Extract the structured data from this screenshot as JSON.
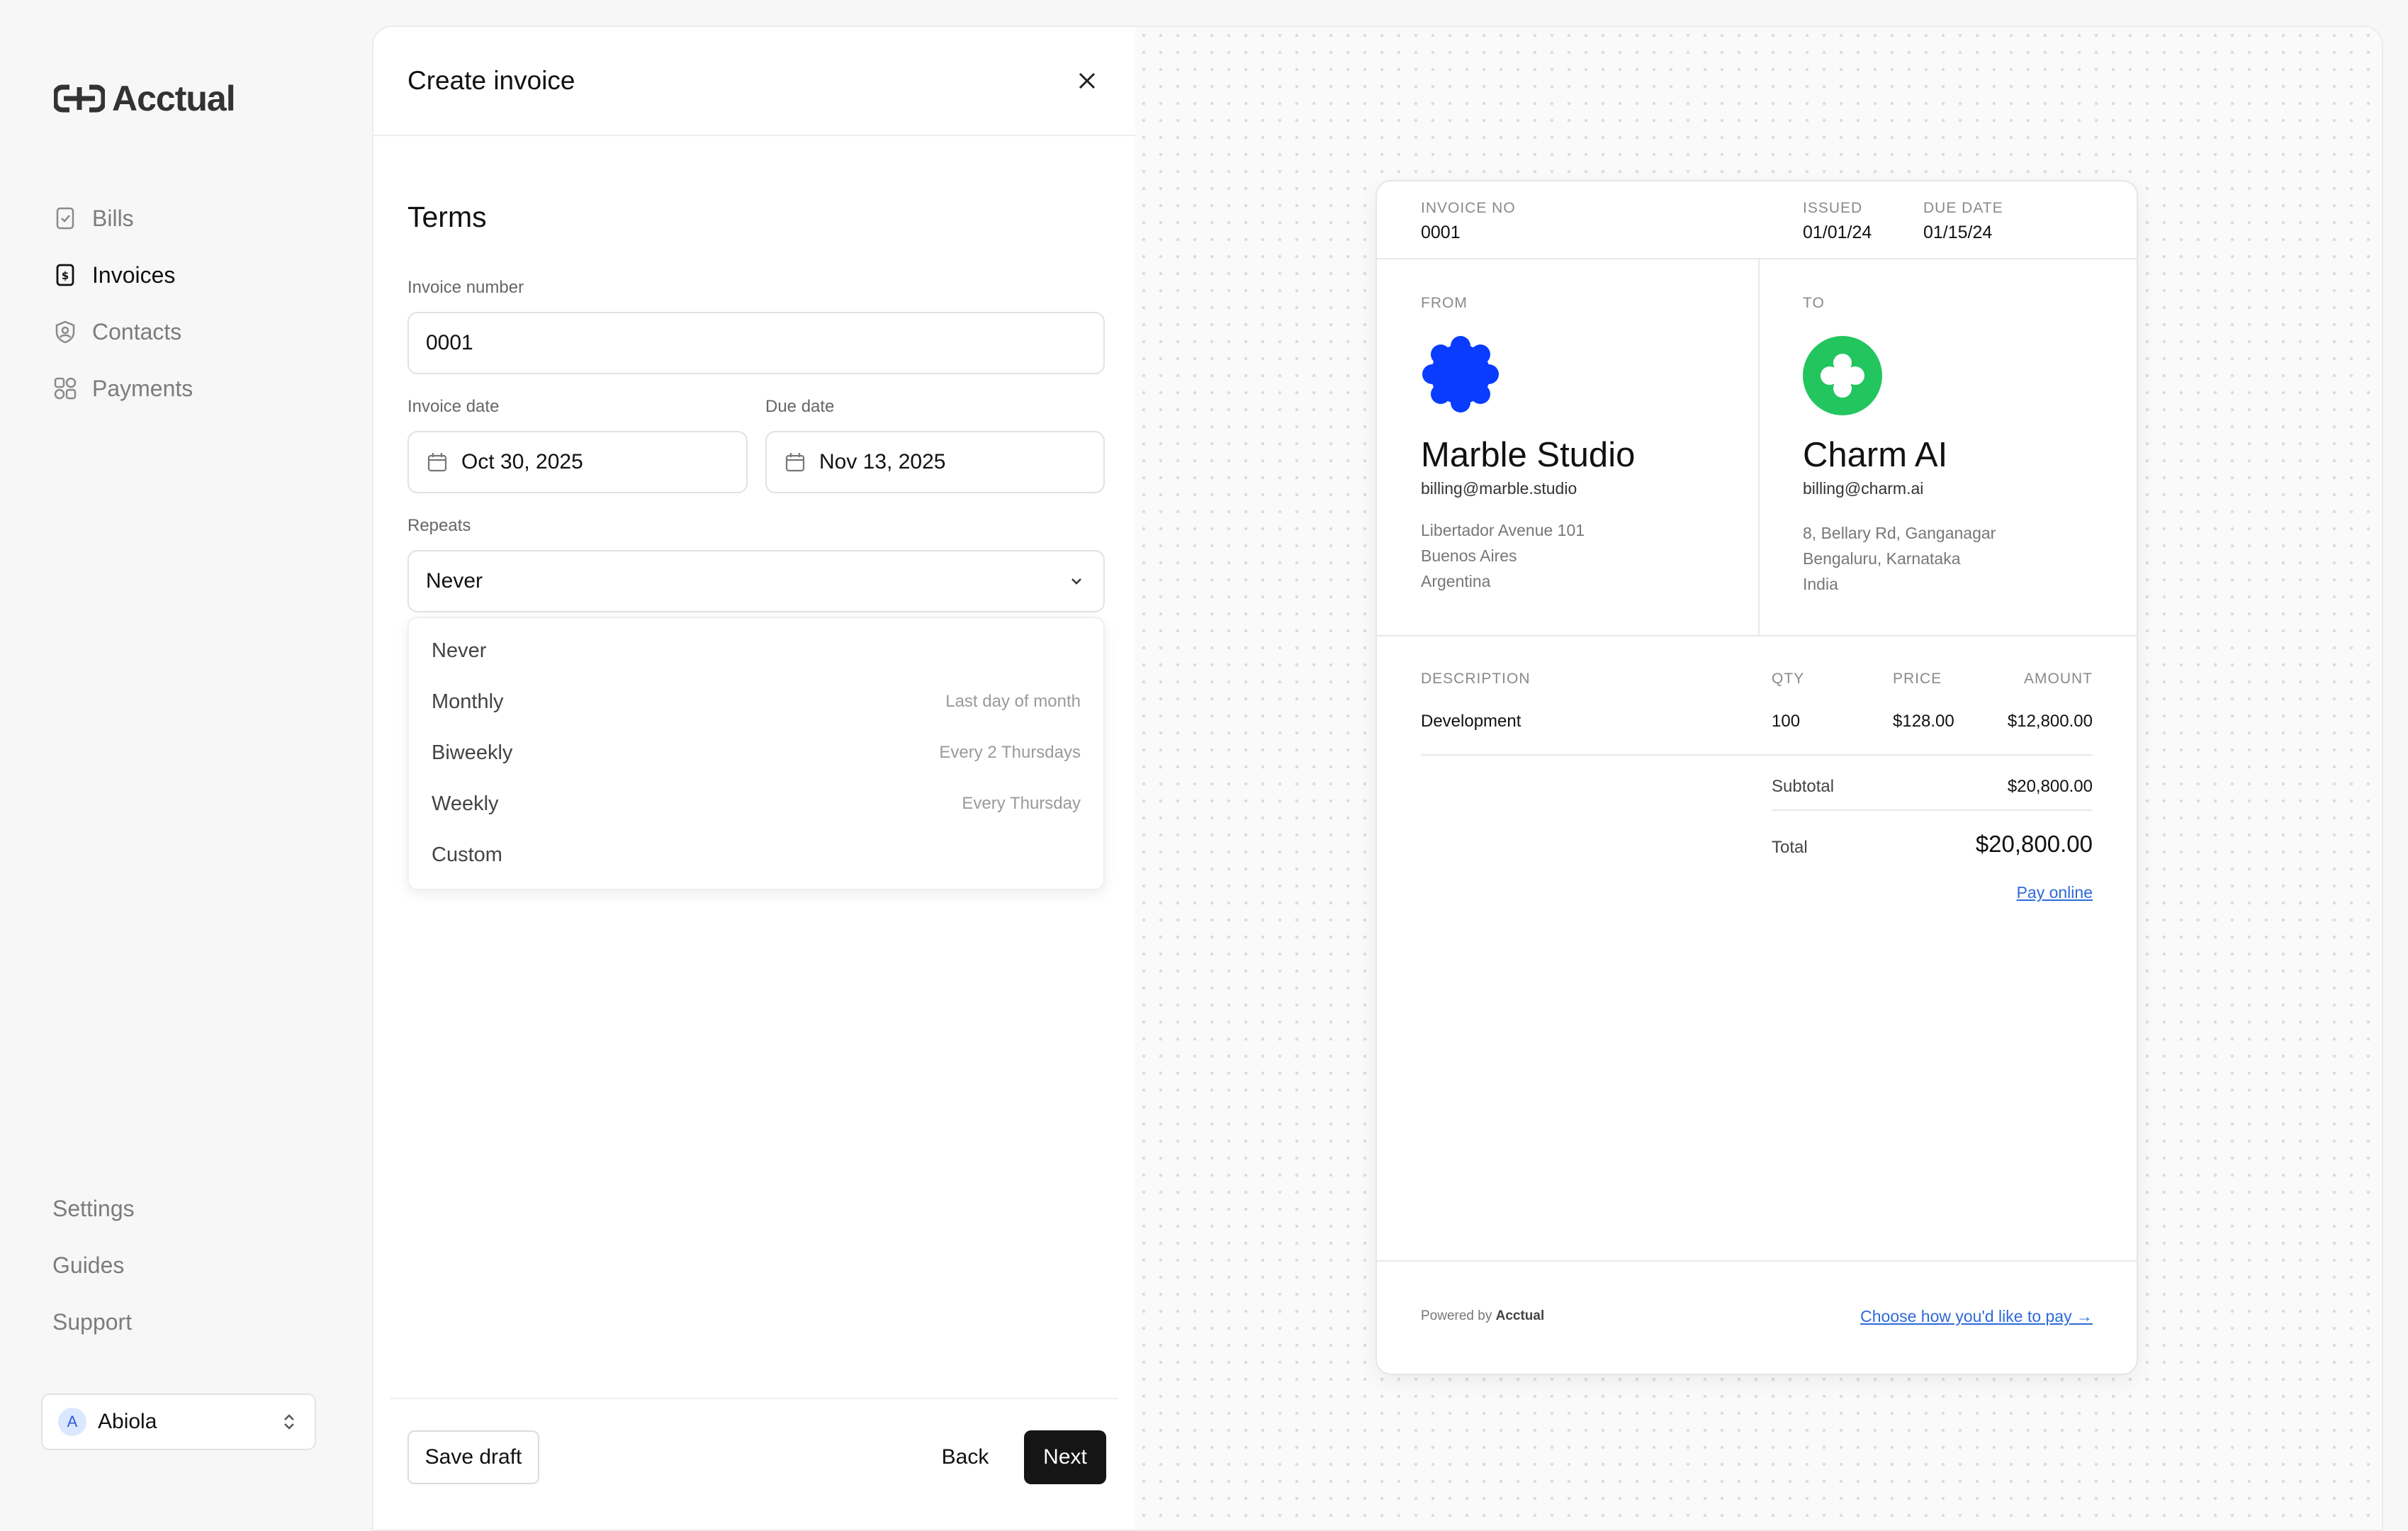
{
  "app": {
    "name": "Acctual"
  },
  "sidebar": {
    "items": [
      {
        "label": "Bills",
        "icon": "bill-icon"
      },
      {
        "label": "Invoices",
        "icon": "invoice-icon",
        "active": true
      },
      {
        "label": "Contacts",
        "icon": "contact-icon"
      },
      {
        "label": "Payments",
        "icon": "payments-icon"
      }
    ],
    "bottom_items": [
      {
        "label": "Settings"
      },
      {
        "label": "Guides"
      },
      {
        "label": "Support"
      }
    ],
    "user": {
      "initial": "A",
      "name": "Abiola"
    }
  },
  "form": {
    "title": "Create invoice",
    "section_title": "Terms",
    "invoice_number": {
      "label": "Invoice number",
      "value": "0001"
    },
    "invoice_date": {
      "label": "Invoice date",
      "value": "Oct 30, 2025"
    },
    "due_date": {
      "label": "Due date",
      "value": "Nov 13, 2025"
    },
    "repeats": {
      "label": "Repeats",
      "value": "Never",
      "options": [
        {
          "label": "Never",
          "hint": ""
        },
        {
          "label": "Monthly",
          "hint": "Last day of month"
        },
        {
          "label": "Biweekly",
          "hint": "Every 2 Thursdays"
        },
        {
          "label": "Weekly",
          "hint": "Every Thursday"
        },
        {
          "label": "Custom",
          "hint": ""
        }
      ]
    },
    "buttons": {
      "save_draft": "Save draft",
      "back": "Back",
      "next": "Next"
    }
  },
  "invoice": {
    "invoice_no_label": "INVOICE NO",
    "invoice_no": "0001",
    "issued_label": "ISSUED",
    "issued": "01/01/24",
    "due_label": "DUE DATE",
    "due": "01/15/24",
    "from": {
      "label": "FROM",
      "name": "Marble Studio",
      "email": "billing@marble.studio",
      "address": [
        "Libertador Avenue 101",
        "Buenos Aires",
        "Argentina"
      ],
      "logo_color": "#0a3cff"
    },
    "to": {
      "label": "TO",
      "name": "Charm AI",
      "email": "billing@charm.ai",
      "address": [
        "8, Bellary Rd, Ganganagar",
        "Bengaluru, Karnataka",
        "India"
      ],
      "logo_color": "#22c55e"
    },
    "table": {
      "headers": [
        "DESCRIPTION",
        "QTY",
        "PRICE",
        "AMOUNT"
      ],
      "rows": [
        {
          "description": "Development",
          "qty": "100",
          "price": "$128.00",
          "amount": "$12,800.00"
        }
      ]
    },
    "subtotal_label": "Subtotal",
    "subtotal": "$20,800.00",
    "total_label": "Total",
    "total": "$20,800.00",
    "pay_online": "Pay online",
    "powered_by": "Powered by",
    "powered_brand": "Acctual",
    "choose_pay": "Choose how you'd like to pay →"
  }
}
